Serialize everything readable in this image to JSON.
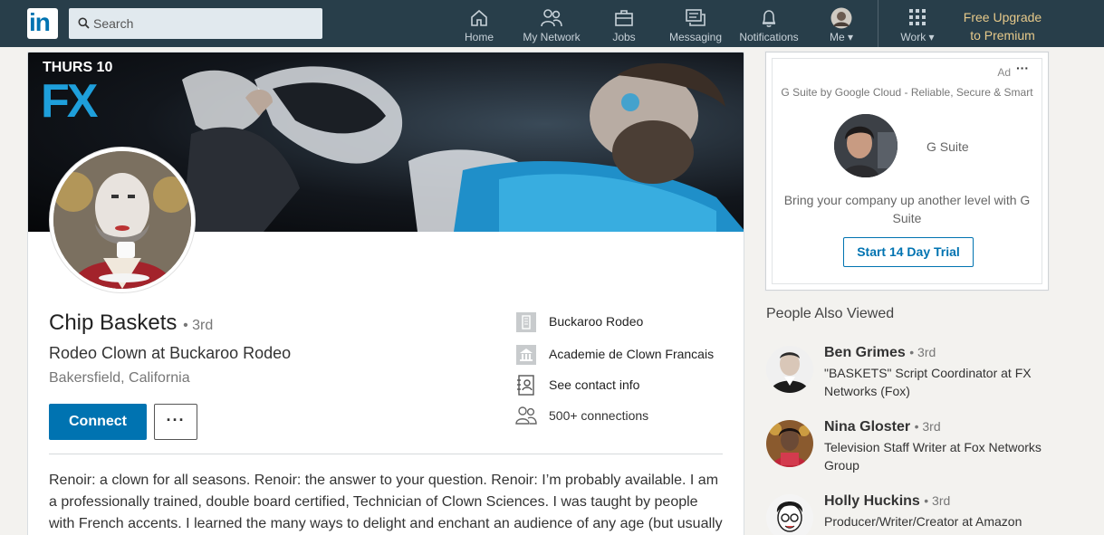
{
  "nav": {
    "logo": "in",
    "search_placeholder": "Search",
    "items": [
      {
        "label": "Home"
      },
      {
        "label": "My Network"
      },
      {
        "label": "Jobs"
      },
      {
        "label": "Messaging"
      },
      {
        "label": "Notifications"
      },
      {
        "label": "Me"
      },
      {
        "label": "Work"
      }
    ],
    "premium_line1": "Free Upgrade",
    "premium_line2": "to Premium"
  },
  "banner": {
    "line1": "THURS 10",
    "line2": "FX"
  },
  "profile": {
    "name": "Chip Baskets",
    "degree": "• 3rd",
    "headline": "Rodeo Clown at Buckaroo Rodeo",
    "location": "Bakersfield, California",
    "connect_label": "Connect",
    "more_label": "···",
    "company": "Buckaroo Rodeo",
    "school": "Academie de Clown Francais",
    "contact": "See contact info",
    "connections": "500+ connections",
    "about": "Renoir: a clown for all seasons. Renoir: the answer to your question. Renoir: I’m probably available. I am a professionally trained, double board certified, Technician of Clown Sciences. I was taught by people with French accents. I learned the many ways to delight and enchant an audience of any age (but usually not"
  },
  "ad": {
    "label": "Ad",
    "dots": "···",
    "sponsor": "G Suite by Google Cloud - Reliable, Secure & Smart",
    "brand": "G Suite",
    "text": "Bring your company up another level with G Suite",
    "cta": "Start 14 Day Trial"
  },
  "people_also_viewed": {
    "title": "People Also Viewed",
    "people": [
      {
        "name": "Ben Grimes",
        "degree": "• 3rd",
        "headline": "\"BASKETS\" Script Coordinator at FX Networks (Fox)"
      },
      {
        "name": "Nina Gloster",
        "degree": "• 3rd",
        "headline": "Television Staff Writer at Fox Networks Group"
      },
      {
        "name": "Holly Huckins",
        "degree": "• 3rd",
        "headline": "Producer/Writer/Creator at Amazon Studios"
      }
    ]
  },
  "colors": {
    "nav_bg": "#283e4a",
    "primary": "#0073b1",
    "premium": "#e6c98a",
    "fx_blue": "#1e9fdb"
  }
}
